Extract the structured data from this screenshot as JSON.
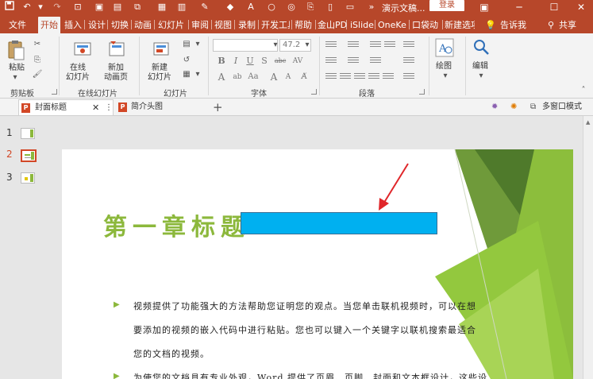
{
  "app": {
    "doc_title": "演示文稿...",
    "login_label": "登录"
  },
  "ribbon_tabs": [
    {
      "label": "文件",
      "active": false
    },
    {
      "label": "开始",
      "active": true
    },
    {
      "label": "插入",
      "active": false
    },
    {
      "label": "设计",
      "active": false
    },
    {
      "label": "切换",
      "active": false
    },
    {
      "label": "动画",
      "active": false
    },
    {
      "label": "幻灯片",
      "active": false
    },
    {
      "label": "审阅",
      "active": false
    },
    {
      "label": "视图",
      "active": false
    },
    {
      "label": "录制",
      "active": false
    },
    {
      "label": "开发工具",
      "active": false
    },
    {
      "label": "帮助",
      "active": false
    },
    {
      "label": "金山PD",
      "active": false
    },
    {
      "label": "iSlide",
      "active": false
    },
    {
      "label": "OneKe",
      "active": false
    },
    {
      "label": "口袋动",
      "active": false
    },
    {
      "label": "新建选项",
      "active": false
    }
  ],
  "tell_me": {
    "icon": "lightbulb-icon",
    "label": "告诉我"
  },
  "share": {
    "icon": "person-icon",
    "label": "共享"
  },
  "ribbon": {
    "paste_label": "粘贴",
    "clipboard_label": "剪贴板",
    "online_slides_label": "在线\n幻灯片",
    "new_anim_page_label": "新加\n动画页",
    "online_slides_group": "在线幻灯片",
    "new_slide_label": "新建\n幻灯片",
    "slides_group": "幻灯片",
    "font_size": "47.2",
    "font_group": "字体",
    "paragraph_group": "段落",
    "drawing_label": "绘图",
    "editing_label": "编辑"
  },
  "doc_tabs": {
    "tab1": "封面标题",
    "tab2": "简介头图",
    "add": "+",
    "multi_window": "多窗口模式"
  },
  "thumbnails": [
    {
      "num": "1",
      "selected": false
    },
    {
      "num": "2",
      "selected": true
    },
    {
      "num": "3",
      "selected": false
    }
  ],
  "slide": {
    "title": "第一章标题",
    "paragraph1_line1": "视频提供了功能强大的方法帮助您证明您的观点。当您单击联机视频时，可以在想",
    "paragraph1_line2": "要添加的视频的嵌入代码中进行粘贴。您也可以键入一个关键字以联机搜索最适合",
    "paragraph1_line3": "您的文档的视频。",
    "paragraph2_line1": "为使您的文档具有专业外观，Word 提供了页眉、页脚、封面和文本框设计，这些设"
  },
  "colors": {
    "brand": "#b7472a",
    "title_green": "#8cb83c",
    "rect_blue": "#00b0f0",
    "arrow_red": "#e0262a"
  }
}
